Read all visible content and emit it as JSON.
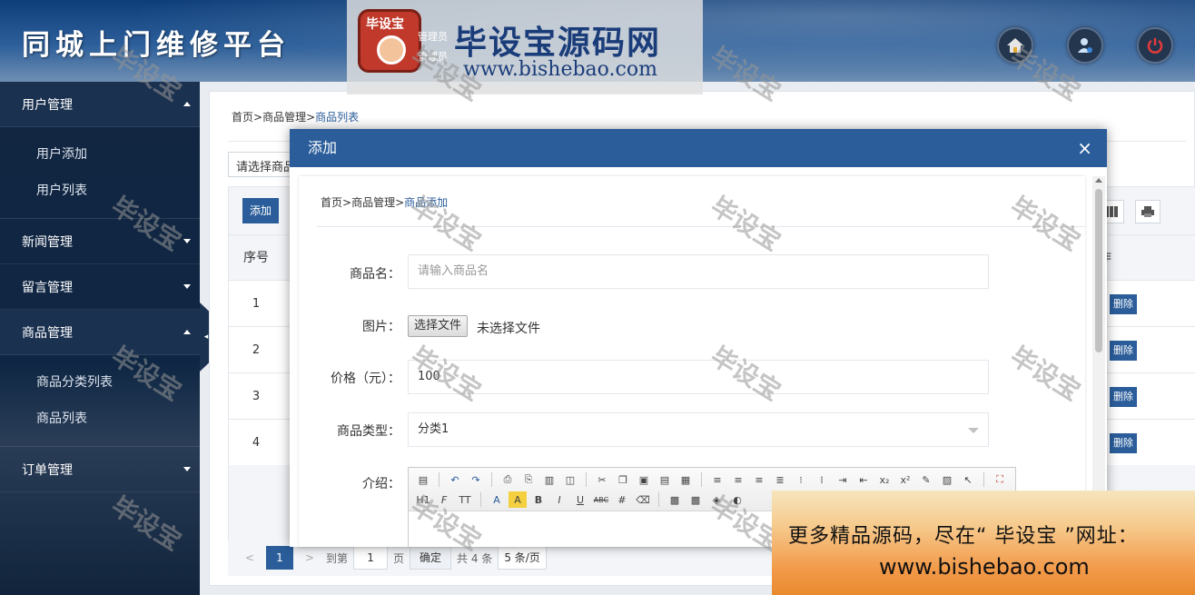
{
  "header": {
    "brand": "同城上门维修平台",
    "logo_title": "毕设宝源码网",
    "logo_url": "www.bishebao.com",
    "logo_badge_text": "毕设宝",
    "admin_line1": "管理员",
    "admin_line2": "管理员",
    "buttons": [
      {
        "name": "home-icon",
        "color": "#e6e6e6"
      },
      {
        "name": "user-profile-icon",
        "color": "#cfe3f7"
      },
      {
        "name": "power-icon",
        "color": "#e33b3b"
      }
    ]
  },
  "sidebar": {
    "groups": [
      {
        "label": "用户管理",
        "open": true,
        "items": [
          "用户添加",
          "用户列表"
        ]
      },
      {
        "label": "新闻管理",
        "open": false,
        "items": []
      },
      {
        "label": "留言管理",
        "open": false,
        "items": []
      },
      {
        "label": "商品管理",
        "open": true,
        "items": [
          "商品分类列表",
          "商品列表"
        ]
      },
      {
        "label": "订单管理",
        "open": false,
        "items": []
      }
    ],
    "toggle_icon": "◂"
  },
  "main": {
    "breadcrumb": [
      "首页",
      "商品管理",
      "商品列表"
    ],
    "breadcrumb_sep": ">",
    "filter_select": "请选择商品",
    "add_button": "添加",
    "table": {
      "col_seq": "序号",
      "col_op": "作",
      "rows": [
        "1",
        "2",
        "3",
        "4"
      ],
      "delete_label": "删除"
    },
    "pager": {
      "prev": "<",
      "current": "1",
      "next": ">",
      "goto_label": "到第",
      "goto_value": "1",
      "page_unit": "页",
      "confirm": "确定",
      "total": "共 4 条",
      "page_size": "5 条/页"
    }
  },
  "modal": {
    "title": "添加",
    "close_icon": "×",
    "breadcrumb": [
      "首页",
      "商品管理",
      "商品添加"
    ],
    "fields": {
      "name_label": "商品名：",
      "name_placeholder": "请输入商品名",
      "image_label": "图片：",
      "file_button": "选择文件",
      "file_status": "未选择文件",
      "price_label": "价格（元）：",
      "price_value": "100",
      "type_label": "商品类型：",
      "type_value": "分类1",
      "desc_label": "介绍："
    },
    "toolbar_row2": [
      "H1",
      "F",
      "TT",
      "A",
      "A",
      "B",
      "I",
      "U",
      "ABC"
    ]
  },
  "watermark": "毕设宝",
  "promo": {
    "line1": "更多精品源码，尽在“ 毕设宝 ”网址：",
    "line2": "www.bishebao.com"
  }
}
